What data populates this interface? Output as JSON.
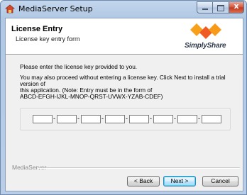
{
  "window": {
    "title": "MediaServer Setup",
    "close_glyph": "x"
  },
  "header": {
    "title": "License Entry",
    "subtitle": "License key entry form",
    "logo_text": "SimplyShare",
    "logo_icon": "simplyshare-diamonds-logo",
    "logo_colors": [
      "#f7a11a",
      "#f05a23",
      "#f79a1a"
    ]
  },
  "content": {
    "prompt": "Please enter the license key provided to you.",
    "info_line1": "You may also proceed without entering a license key. Click Next to install a trial version of",
    "info_line2": "this application. (Note: Entry must be in the form of",
    "info_line3": "ABCD-EFGH-IJKL-MNOP-QRST-UVWX-YZAB-CDEF)"
  },
  "license_key": {
    "separator": "-",
    "segments": [
      "",
      "",
      "",
      "",
      "",
      "",
      "",
      ""
    ]
  },
  "footer": {
    "label": "MediaServer",
    "back_label": "< Back",
    "next_label": "Next >",
    "cancel_label": "Cancel"
  }
}
